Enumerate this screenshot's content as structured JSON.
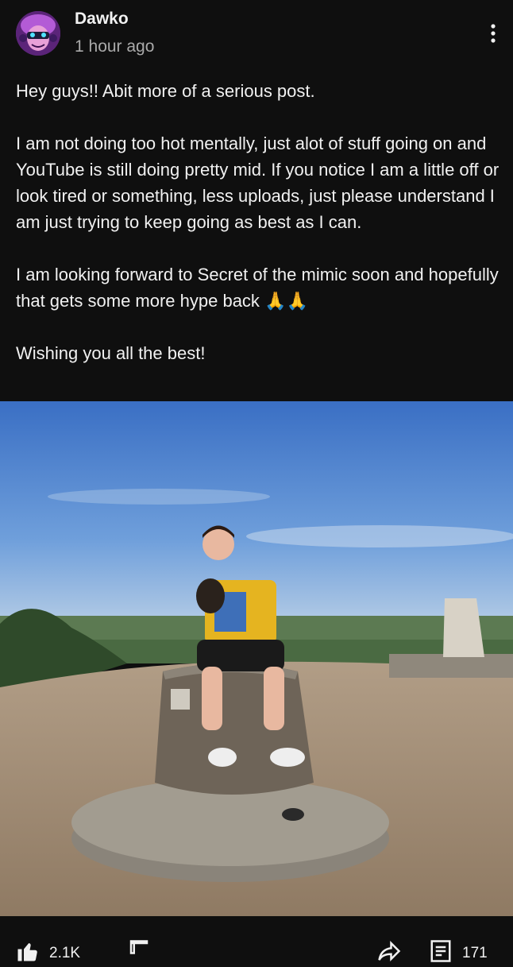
{
  "post": {
    "author": "Dawko",
    "time": "1 hour ago",
    "paragraphs": [
      "Hey guys!! Abit more of a serious post.",
      "I am not doing too hot mentally, just alot of stuff going on and YouTube is still doing pretty mid. If you notice I am a little off or look tired or something, less uploads, just please understand I am just trying to keep going as best as I can.",
      "I am looking forward to Secret of the mimic soon and hopefully that gets some more hype back 🙏🙏",
      "Wishing you all the best!"
    ]
  },
  "actions": {
    "like_count": "2.1K",
    "comment_count": "171"
  },
  "icons": {
    "like": "thumbs-up-icon",
    "dislike": "thumbs-down-icon",
    "share": "share-icon",
    "comment": "comment-icon",
    "more": "more-vert-icon"
  },
  "colors": {
    "background": "#0f0f0f",
    "text_primary": "#f1f1f1",
    "text_secondary": "#aaaaaa"
  }
}
